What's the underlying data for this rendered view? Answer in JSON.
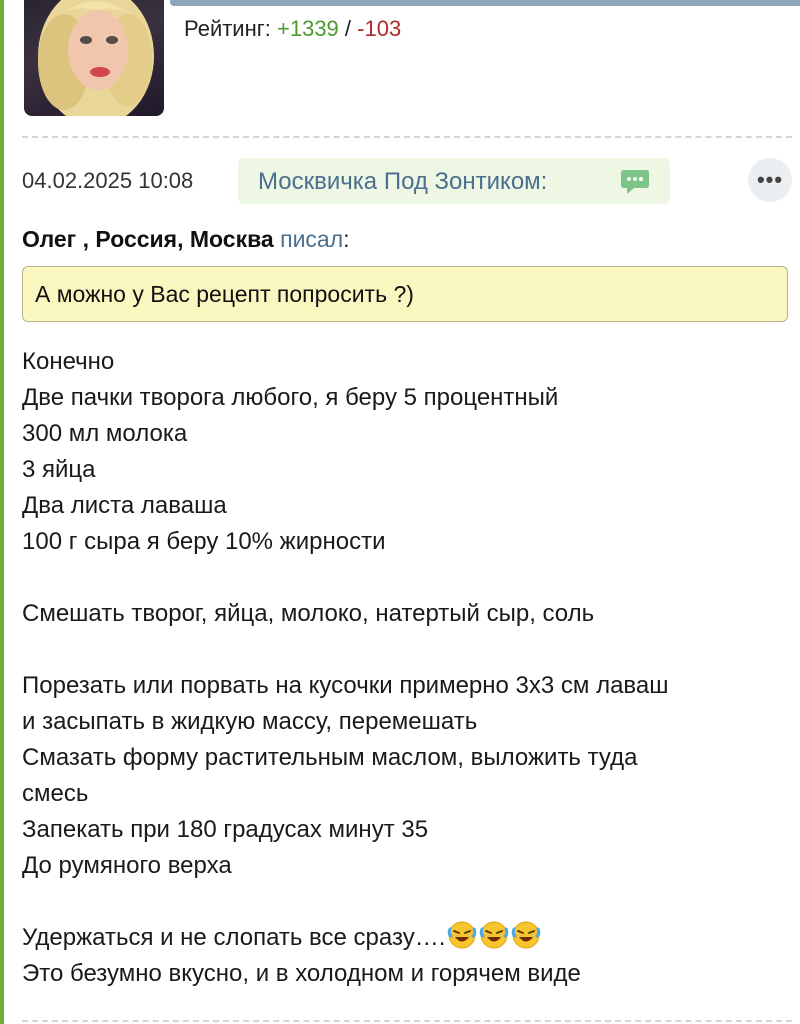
{
  "profile": {
    "rating_label": "Рейтинг: ",
    "rating_positive": "+1339",
    "rating_separator": " / ",
    "rating_negative": "-103"
  },
  "post": {
    "date": "04.02.2025 10:08",
    "author": "Москвичка Под Зонтиком:",
    "more_icon": "more-options-icon",
    "chat_icon": "chat-bubble-icon",
    "quote_author": "Олег , Россия, Москва",
    "quote_wrote": "писал",
    "quote_colon": ":",
    "quote_text": "А можно у Вас рецепт попросить ?)",
    "lines": [
      "Конечно",
      "Две пачки творога любого, я беру 5 процентный",
      "300 мл молока",
      "3 яйца",
      "Два листа лаваша",
      "100 г сыра я беру 10% жирности",
      "",
      "Смешать творог, яйца, молоко, натертый сыр, соль",
      "",
      "Порезать или порвать на кусочки примерно 3х3 см лаваш",
      "и засыпать в жидкую массу, перемешать",
      "Смазать форму растительным маслом, выложить туда",
      "смесь",
      "Запекать при 180 градусах минут 35",
      "До румяного верха",
      "",
      "Удержаться и не слопать все сразу….",
      "Это безумно вкусно, и в холодном и горячем виде"
    ],
    "emoji_count": 3,
    "emoji_icon": "rolling-laughing-emoji-icon"
  },
  "colors": {
    "positive": "#4a9a2e",
    "negative": "#b02a2a",
    "link": "#4a6f8f",
    "quote_bg": "#fbf7c0",
    "author_pill_bg": "#eef6e4"
  }
}
